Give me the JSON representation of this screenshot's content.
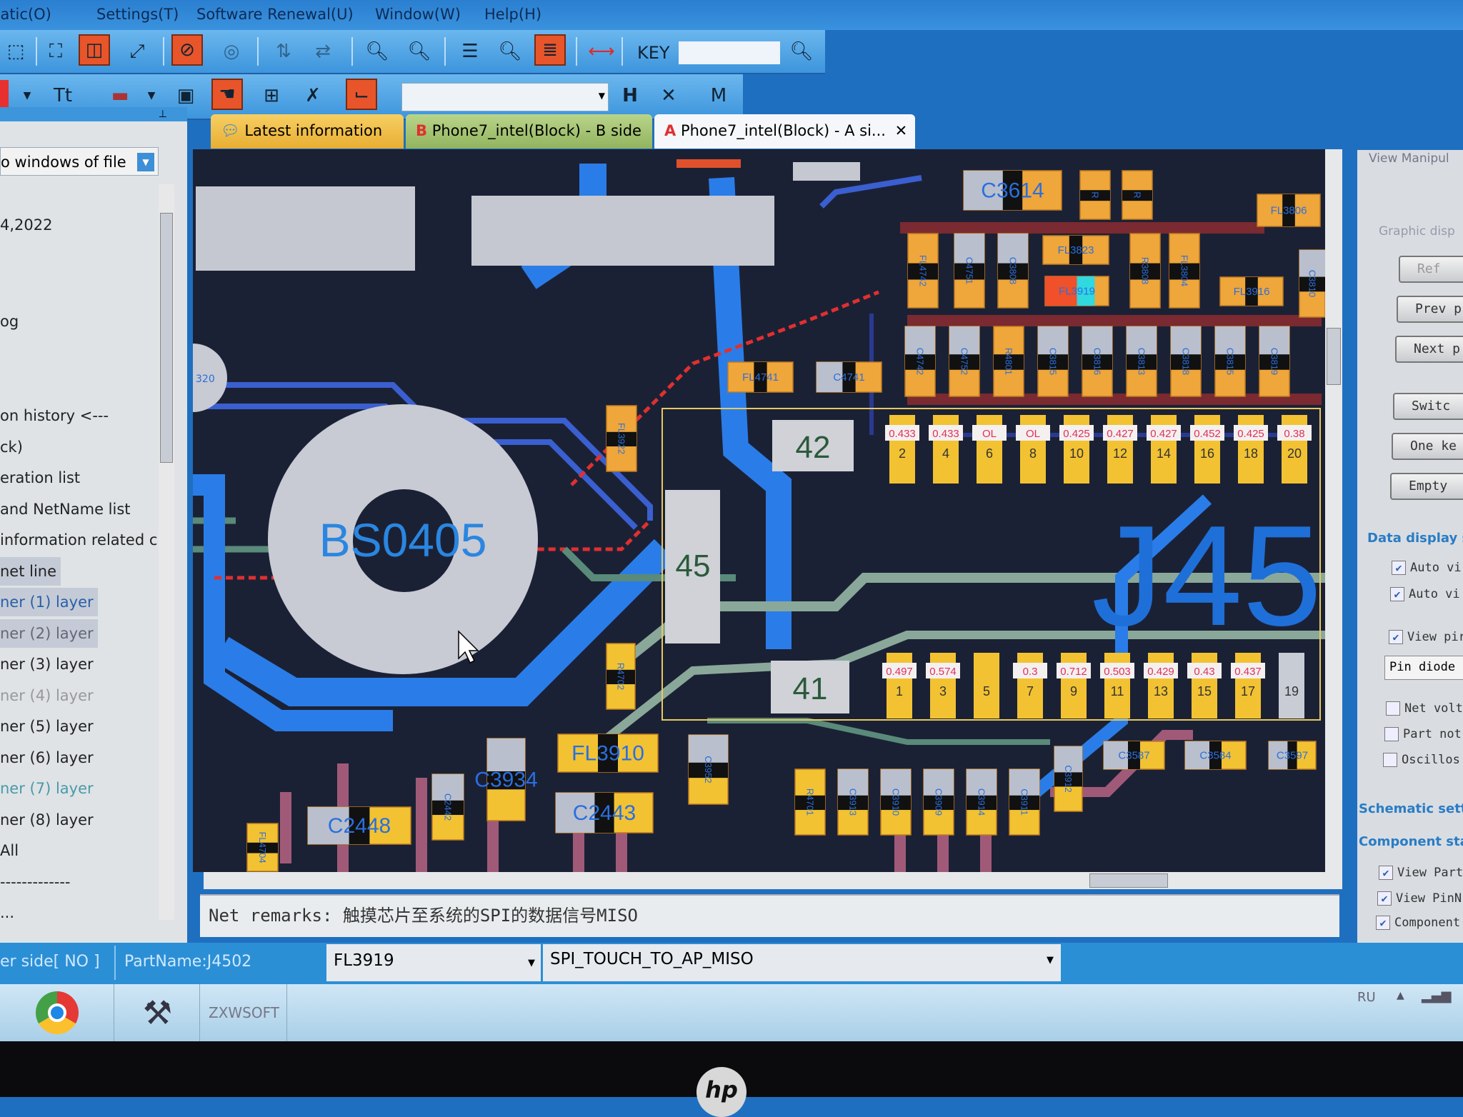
{
  "menu": [
    "matic(O)",
    "Settings(T)",
    "Software Renewal(U)",
    "Window(W)",
    "Help(H)"
  ],
  "toolbar": {
    "key_label": "KEY",
    "key_input": "",
    "net_select": "",
    "icons": [
      "frame-icon",
      "fit-icon",
      "dual-view-icon",
      "resize-icon",
      "check-icon",
      "circle-icon",
      "flip-h-icon",
      "flip-v-icon",
      "zoom-out-icon",
      "zoom-in-icon",
      "split-icon",
      "zoom-area-icon",
      "list-icon",
      "measure-icon"
    ]
  },
  "left_panel": {
    "header": "o windows of file",
    "items": [
      "4,2022",
      "og",
      "on history <---",
      "ck)",
      "eration list",
      " and NetName list",
      " information related c",
      " net line",
      "ner (1) layer",
      "ner (2) layer",
      "ner (3) layer",
      "ner (4) layer",
      "ner (5) layer",
      "ner (6) layer",
      "ner (7) layer",
      "ner (8) layer",
      "All",
      "-------------",
      "..."
    ]
  },
  "tabs": [
    {
      "label": "Latest information",
      "active": false
    },
    {
      "label": "Phone7_intel(Block) - B side",
      "badge": "B",
      "active": false
    },
    {
      "label": "Phone7_intel(Block) - A si...",
      "badge": "A",
      "active": true
    }
  ],
  "board": {
    "big_part": "BS0405",
    "connector": "J45",
    "side_part": "320",
    "labels": {
      "box_42": "42",
      "box_45": "45",
      "box_41": "41"
    },
    "pins_even": [
      {
        "pin": "2",
        "value": "0.433"
      },
      {
        "pin": "4",
        "value": "0.433"
      },
      {
        "pin": "6",
        "value": "OL"
      },
      {
        "pin": "8",
        "value": "OL"
      },
      {
        "pin": "10",
        "value": "0.425"
      },
      {
        "pin": "12",
        "value": "0.427"
      },
      {
        "pin": "14",
        "value": "0.427"
      },
      {
        "pin": "16",
        "value": "0.452"
      },
      {
        "pin": "18",
        "value": "0.425"
      },
      {
        "pin": "20",
        "value": "0.38"
      }
    ],
    "pins_odd": [
      {
        "pin": "1",
        "value": "0.497"
      },
      {
        "pin": "3",
        "value": "0.574"
      },
      {
        "pin": "5",
        "value": ""
      },
      {
        "pin": "7",
        "value": "0.3"
      },
      {
        "pin": "9",
        "value": "0.712"
      },
      {
        "pin": "11",
        "value": "0.503"
      },
      {
        "pin": "13",
        "value": "0.429"
      },
      {
        "pin": "15",
        "value": "0.43"
      },
      {
        "pin": "17",
        "value": "0.437"
      },
      {
        "pin": "19",
        "value": ""
      }
    ],
    "components": [
      "C3614",
      "R",
      "R",
      "FL3806",
      "FL4742",
      "C4751",
      "C3808",
      "FL3823",
      "FL3919",
      "R3808",
      "FL3804",
      "FL3916",
      "C3810",
      "C4742",
      "C4752",
      "R4801",
      "C3815",
      "C3816",
      "C3813",
      "C3818",
      "C3815",
      "C3819",
      "FL4741",
      "C4741",
      "FL3922",
      "R4702",
      "C2448",
      "C2442",
      "C3934",
      "FL3910",
      "C2443",
      "C3952",
      "R4701",
      "C3913",
      "C3910",
      "C3909",
      "C3914",
      "C3911",
      "C3912",
      "C3587",
      "C3584",
      "C3597",
      "FL4704"
    ],
    "selected_component": "FL3919"
  },
  "net_remarks": "Net remarks: 触摸芯片至系统的SPI的数据信号MISO",
  "right_panel": {
    "title": "View Manipul",
    "graphic_section": "Graphic disp",
    "buttons": [
      "Ref",
      "Prev p",
      "Next p",
      "Switc",
      "One ke",
      "Empty"
    ],
    "data_section": "Data display se",
    "checks": [
      {
        "label": "Auto vi",
        "checked": true
      },
      {
        "label": "Auto vi",
        "checked": true
      },
      {
        "label": "View pir",
        "checked": true
      }
    ],
    "pin_mode_select": "Pin diode",
    "checks2": [
      {
        "label": "Net volt",
        "checked": false
      },
      {
        "label": "Part not",
        "checked": false
      },
      {
        "label": "Oscillos",
        "checked": false
      }
    ],
    "schematic_section": "Schematic settin",
    "component_section": "Component stat",
    "checks3": [
      {
        "label": "View Part",
        "checked": true
      },
      {
        "label": "View PinN",
        "checked": true
      },
      {
        "label": "Component",
        "checked": true
      }
    ]
  },
  "status": {
    "side": "er side[ NO ]",
    "part": "PartName:J4502",
    "part_select": "FL3919",
    "net_select": "SPI_TOUCH_TO_AP_MISO"
  },
  "taskbar": {
    "apps": [
      "chrome-icon",
      "tools-icon",
      "ZXWSOFT"
    ],
    "tray_lang": "RU"
  },
  "colors": {
    "pad": "#f2c232",
    "pad_orange": "#efa63a",
    "board_bg": "#1b2135",
    "trace_blue": "#1f6fd8",
    "selected_red": "#f0502a",
    "selected_cyan": "#30d8e0",
    "value_text": "#e0305a"
  },
  "brand": "hp"
}
